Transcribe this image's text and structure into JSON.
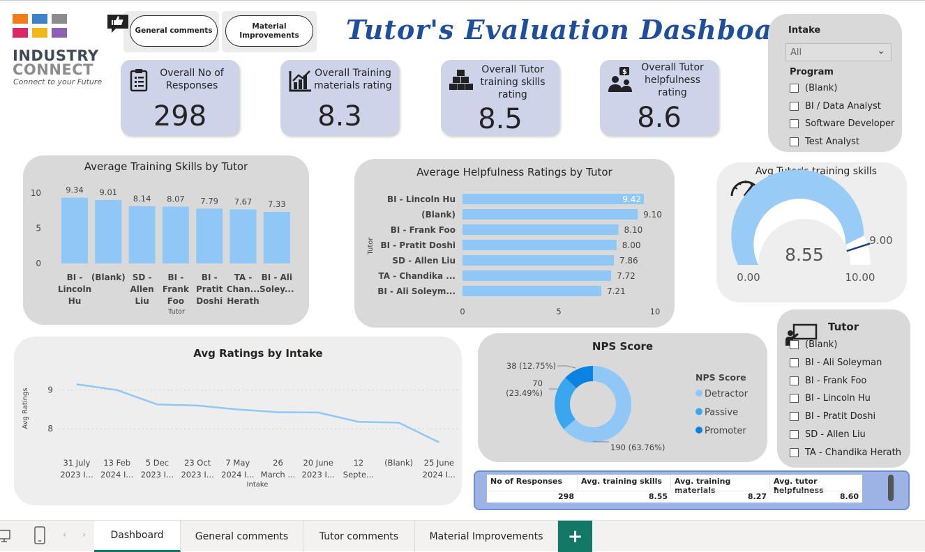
{
  "logo": {
    "title_line1": "INDUSTRY",
    "title_line2": "CONNECT",
    "tagline": "Connect to your Future"
  },
  "nav": {
    "general_comments": "General comments",
    "material_improvements": "Material Improvements"
  },
  "title": "Tutor's  Evaluation  Dashboard",
  "kpis": [
    {
      "label": "Overall No of Responses",
      "value": "298",
      "icon": "clipboard-icon"
    },
    {
      "label": "Overall Training materials rating",
      "value": "8.3",
      "icon": "bar-chart-icon"
    },
    {
      "label": "Overall Tutor training skills rating",
      "value": "8.5",
      "icon": "boxes-icon"
    },
    {
      "label": "Overall Tutor helpfulness rating",
      "value": "8.6",
      "icon": "helping-people-icon"
    }
  ],
  "intake_filter": {
    "label": "Intake",
    "selected": "All"
  },
  "program_filter": {
    "label": "Program",
    "items": [
      "(Blank)",
      "BI / Data Analyst",
      "Software Developer",
      "Test Analyst"
    ]
  },
  "tutor_filter": {
    "label": "Tutor",
    "items": [
      "(Blank)",
      "BI - Ali Soleyman",
      "BI - Frank Foo",
      "BI - Lincoln Hu",
      "BI - Pratit Doshi",
      "SD - Allen Liu",
      "TA - Chandika Herath"
    ]
  },
  "training_skills_chart": {
    "title": "Average Training Skills by Tutor",
    "xlabel": "Tutor",
    "yticks": [
      "10",
      "5",
      "0"
    ],
    "categories": [
      [
        "BI -",
        "Lincoln",
        "Hu"
      ],
      [
        "(Blank)"
      ],
      [
        "SD -",
        "Allen",
        "Liu"
      ],
      [
        "BI -",
        "Frank",
        "Foo"
      ],
      [
        "BI -",
        "Pratit",
        "Doshi"
      ],
      [
        "TA -",
        "Chan...",
        "Herath"
      ],
      [
        "BI - Ali",
        "Soley..."
      ]
    ],
    "values": [
      9.34,
      9.01,
      8.14,
      8.07,
      7.79,
      7.67,
      7.33
    ],
    "labels": [
      "9.34",
      "9.01",
      "8.14",
      "8.07",
      "7.79",
      "7.67",
      "7.33"
    ],
    "ylim": [
      0,
      10
    ],
    "color": "#8fc7f6"
  },
  "helpfulness_chart": {
    "title": "Average Helpfulness Ratings by Tutor",
    "ylabel": "Tutor",
    "categories": [
      "BI - Lincoln Hu",
      "(Blank)",
      "BI - Frank Foo",
      "BI - Pratit Doshi",
      "SD - Allen Liu",
      "TA - Chandika ...",
      "BI - Ali Soleym..."
    ],
    "values": [
      9.42,
      9.1,
      8.1,
      8.0,
      7.86,
      7.72,
      7.21
    ],
    "labels": [
      "9.42",
      "9.10",
      "8.10",
      "8.00",
      "7.86",
      "7.72",
      "7.21"
    ],
    "xticks": [
      "0",
      "5",
      "10"
    ],
    "xlim": [
      0,
      10
    ],
    "color": "#8fc7f6"
  },
  "gauge": {
    "title": "Avg Tutor's training skills ratings",
    "value": 8.55,
    "value_label": "8.55",
    "min_label": "0.00",
    "max_label": "10.00",
    "target": 9.0,
    "target_label": "9.00",
    "color": "#99cbf7"
  },
  "intake_chart": {
    "title": "Avg Ratings by Intake",
    "xlabel": "Intake",
    "ylabel": "Avg Ratings",
    "yticks": [
      "9",
      "8"
    ],
    "categories": [
      [
        "31 July",
        "2023 I..."
      ],
      [
        "13 Feb",
        "2024 I..."
      ],
      [
        "5 Dec",
        "2023 I..."
      ],
      [
        "23 Oct",
        "2023 I..."
      ],
      [
        "7 May",
        "2024 I..."
      ],
      [
        "26",
        "March ..."
      ],
      [
        "20 June",
        "2023 I..."
      ],
      [
        "12",
        "Septe..."
      ],
      [
        "(Blank)",
        ""
      ],
      [
        "25 June",
        "2024 I..."
      ]
    ],
    "values": [
      9.15,
      9.0,
      8.63,
      8.6,
      8.5,
      8.43,
      8.42,
      8.18,
      8.16,
      7.65
    ],
    "color": "#8fc7f6"
  },
  "nps": {
    "title": "NPS Score",
    "legend_title": "NPS Score",
    "segments": [
      {
        "name": "Detractor",
        "value": 190,
        "label": "190 (63.76%)",
        "color": "#8fc7f6"
      },
      {
        "name": "Passive",
        "value": 70,
        "label_line1": "70",
        "label_line2": "(23.49%)",
        "color": "#3aa6ef"
      },
      {
        "name": "Promoter",
        "value": 38,
        "label": "38 (12.75%)",
        "color": "#0b82df"
      }
    ]
  },
  "summary_table": {
    "headers": [
      "No of Responses",
      "Avg. training skills",
      "Avg. training materials",
      "Avg. tutor helpfulness"
    ],
    "row": [
      "298",
      "8.55",
      "8.27",
      "8.60"
    ]
  },
  "tabs": [
    "Dashboard",
    "General comments",
    "Tutor comments",
    "Material Improvements"
  ],
  "add_tab": "+"
}
